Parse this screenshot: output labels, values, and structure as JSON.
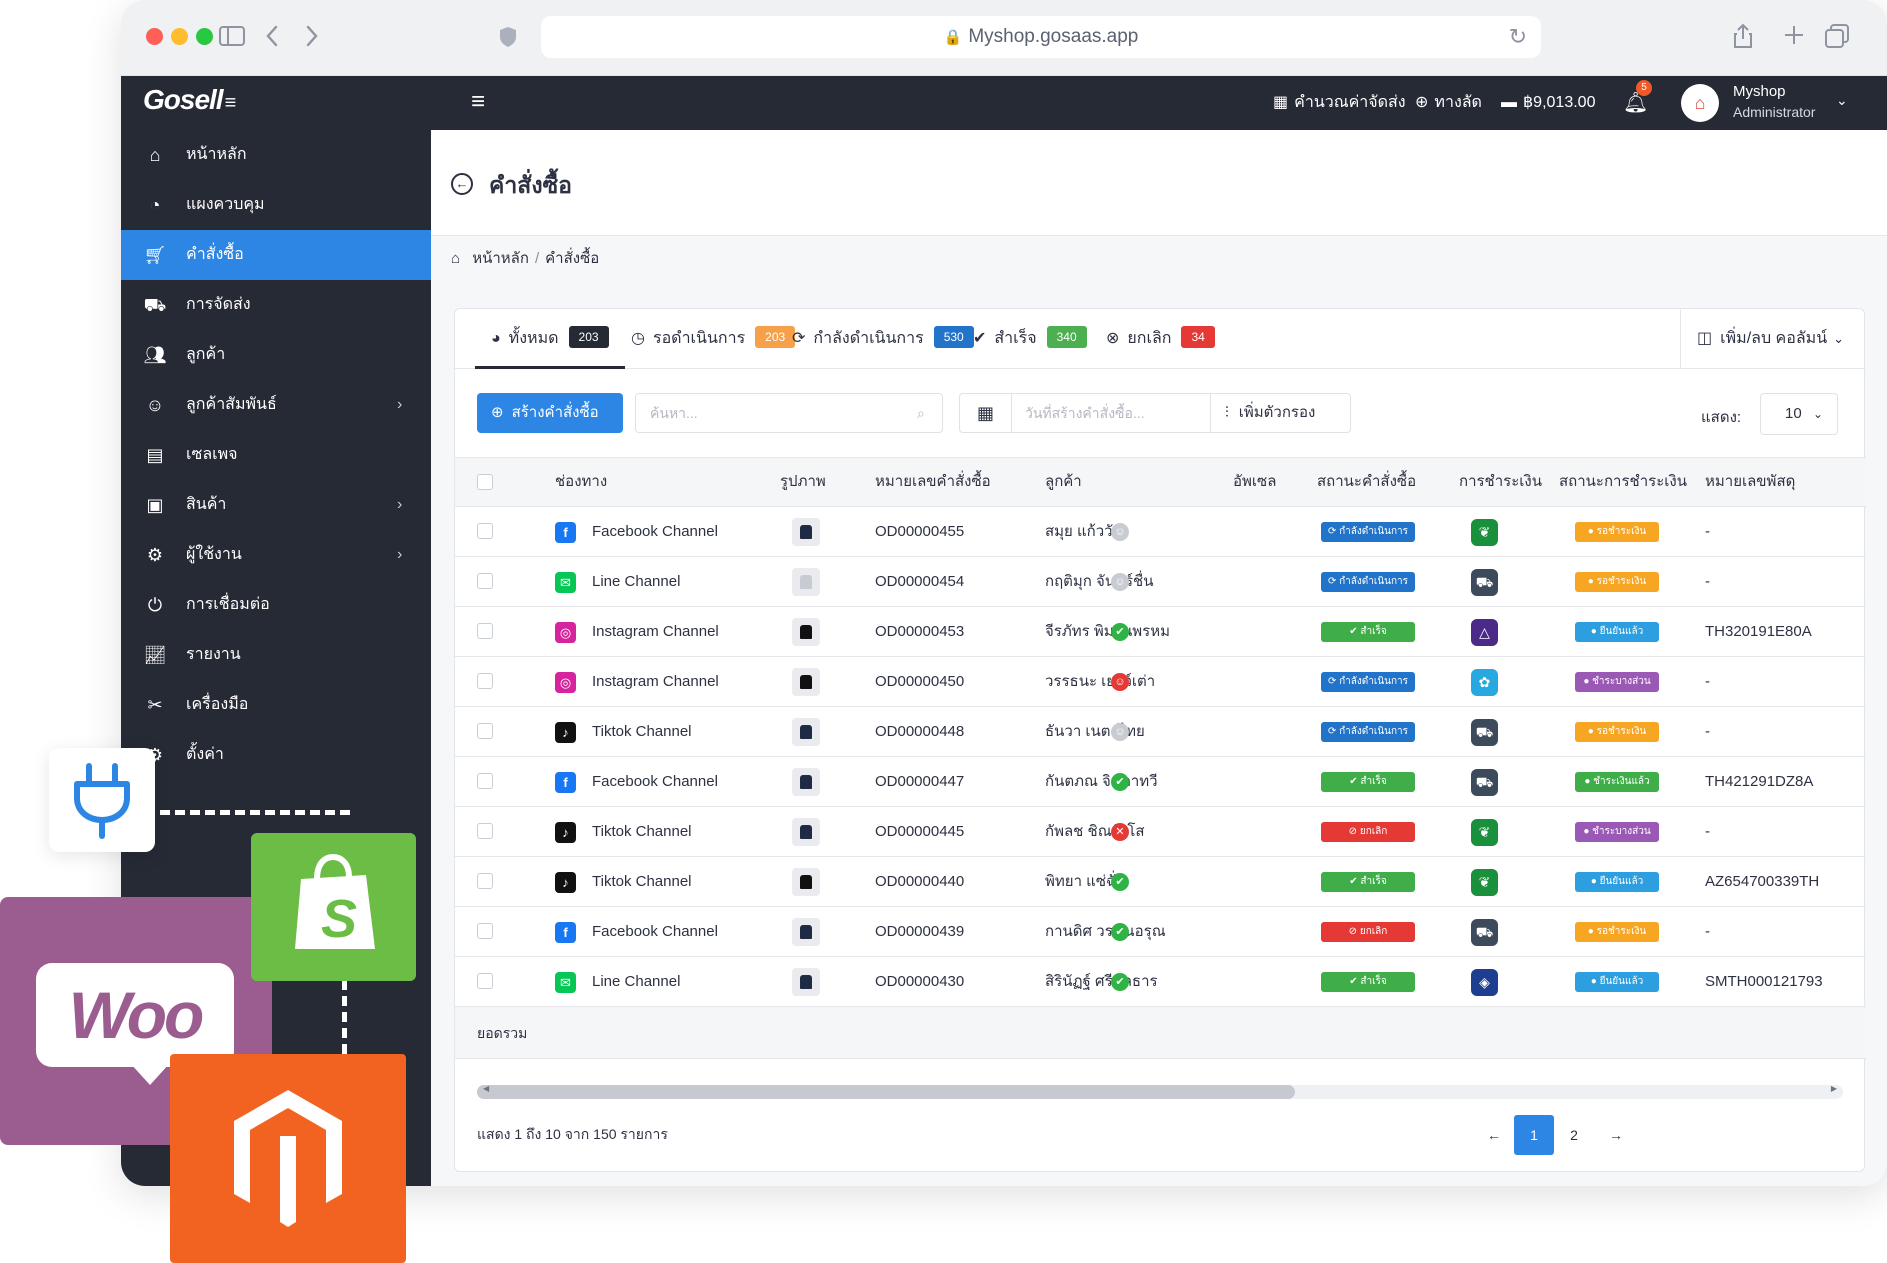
{
  "browser": {
    "url": "Myshop.gosaas.app"
  },
  "topbar": {
    "logo": "Gosell",
    "shipping_calc": "คำนวณค่าจัดส่ง",
    "shortcut": "ทางลัด",
    "balance": "฿9,013.00",
    "notifications": "5",
    "user_name": "Myshop",
    "user_role": "Administrator"
  },
  "sidebar": {
    "items": [
      {
        "label": "หน้าหลัก",
        "icon": "home-icon"
      },
      {
        "label": "แผงควบคุม",
        "icon": "dashboard-icon"
      },
      {
        "label": "คำสั่งซื้อ",
        "icon": "cart-icon"
      },
      {
        "label": "การจัดส่ง",
        "icon": "truck-icon"
      },
      {
        "label": "ลูกค้า",
        "icon": "users-icon"
      },
      {
        "label": "ลูกค้าสัมพันธ์",
        "icon": "crm-icon"
      },
      {
        "label": "เซลเพจ",
        "icon": "salepage-icon"
      },
      {
        "label": "สินค้า",
        "icon": "boxes-icon"
      },
      {
        "label": "ผู้ใช้งาน",
        "icon": "user-gear-icon"
      },
      {
        "label": "การเชื่อมต่อ",
        "icon": "plug-icon"
      },
      {
        "label": "รายงาน",
        "icon": "report-icon"
      },
      {
        "label": "เครื่องมือ",
        "icon": "tools-icon"
      },
      {
        "label": "ตั้งค่า",
        "icon": "settings-icon"
      }
    ]
  },
  "page": {
    "title": "คำสั่งซื้อ",
    "breadcrumb_home": "หน้าหลัก",
    "breadcrumb_current": "คำสั่งซื้อ"
  },
  "tabs": [
    {
      "label": "ทั้งหมด",
      "count": "203",
      "color": "#262a35"
    },
    {
      "label": "รอดำเนินการ",
      "count": "203",
      "color": "#f6a14a"
    },
    {
      "label": "กำลังดำเนินการ",
      "count": "530",
      "color": "#2174c9"
    },
    {
      "label": "สำเร็จ",
      "count": "340",
      "color": "#4caf50"
    },
    {
      "label": "ยกเลิก",
      "count": "34",
      "color": "#e53935"
    }
  ],
  "columns_button": "เพิ่ม/ลบ คอลัมน์",
  "toolbar": {
    "create_label": "สร้างคำสั่งซื้อ",
    "search_placeholder": "ค้นหา...",
    "date_placeholder": "วันที่สร้างคำสั่งซื้อ...",
    "filter_label": "เพิ่มตัวกรอง",
    "show_label": "แสดง:",
    "show_value": "10"
  },
  "table": {
    "headers": [
      "ช่องทาง",
      "รูปภาพ",
      "หมายเลขคำสั่งซื้อ",
      "ลูกค้า",
      "อัพเซล",
      "สถานะคำสั่งซื้อ",
      "การชำระเงิน",
      "สถานะการชำระเงิน",
      "หมายเลขพัสดุ"
    ],
    "rows": [
      {
        "channel": "Facebook Channel",
        "order": "OD00000455",
        "customer": "สมุย แก้ววัน",
        "status": "กำลังดำเนินการ",
        "payment_status": "รอชำระเงิน",
        "tracking": "-"
      },
      {
        "channel": "Line Channel",
        "order": "OD00000454",
        "customer": "กฤติมุก จันทร์ชื่น",
        "status": "กำลังดำเนินการ",
        "payment_status": "รอชำระเงิน",
        "tracking": "-"
      },
      {
        "channel": "Instagram Channel",
        "order": "OD00000453",
        "customer": "จีรภัทร พิมานพรหม",
        "status": "สำเร็จ",
        "payment_status": "ยืนยันแล้ว",
        "tracking": "TH320191E80A"
      },
      {
        "channel": "Instagram Channel",
        "order": "OD00000450",
        "customer": "วรรธนะ เยาว์เต่า",
        "status": "กำลังดำเนินการ",
        "payment_status": "ชำระบางส่วน",
        "tracking": "-"
      },
      {
        "channel": "Tiktok Channel",
        "order": "OD00000448",
        "customer": "ธันวา เนตรไทย",
        "status": "กำลังดำเนินการ",
        "payment_status": "รอชำระเงิน",
        "tracking": "-"
      },
      {
        "channel": "Facebook Channel",
        "order": "OD00000447",
        "customer": "กันตภณ จินดาทวี",
        "status": "สำเร็จ",
        "payment_status": "ชำระเงินแล้ว",
        "tracking": "TH421291DZ8A"
      },
      {
        "channel": "Tiktok Channel",
        "order": "OD00000445",
        "customer": "กัพลช ชิณวังโส",
        "status": "ยกเลิก",
        "payment_status": "ชำระบางส่วน",
        "tracking": "-"
      },
      {
        "channel": "Tiktok Channel",
        "order": "OD00000440",
        "customer": "พิทยา แซ่ฉั่ว",
        "status": "สำเร็จ",
        "payment_status": "ยืนยันแล้ว",
        "tracking": "AZ654700339TH"
      },
      {
        "channel": "Facebook Channel",
        "order": "OD00000439",
        "customer": "กานดิศ วรรณอรุณ",
        "status": "ยกเลิก",
        "payment_status": "รอชำระเงิน",
        "tracking": "-"
      },
      {
        "channel": "Line Channel",
        "order": "OD00000430",
        "customer": "สิรินัฏฐ์ ศรีชลธาร",
        "status": "สำเร็จ",
        "payment_status": "ยืนยันแล้ว",
        "tracking": "SMTH000121793"
      }
    ],
    "total_label": "ยอดรวม"
  },
  "pagination": {
    "info": "แสดง 1 ถึง 10 จาก 150 รายการ",
    "prev": "←",
    "pages": [
      "1",
      "2"
    ],
    "next": "→"
  },
  "colors": {
    "primary": "#2d86e3",
    "sidebar": "#262a35",
    "facebook": "#1877f2",
    "line": "#06c755",
    "tiktok": "#111111",
    "shopify": "#6cbd45",
    "woo": "#9b5c8f",
    "magento": "#f26322"
  }
}
